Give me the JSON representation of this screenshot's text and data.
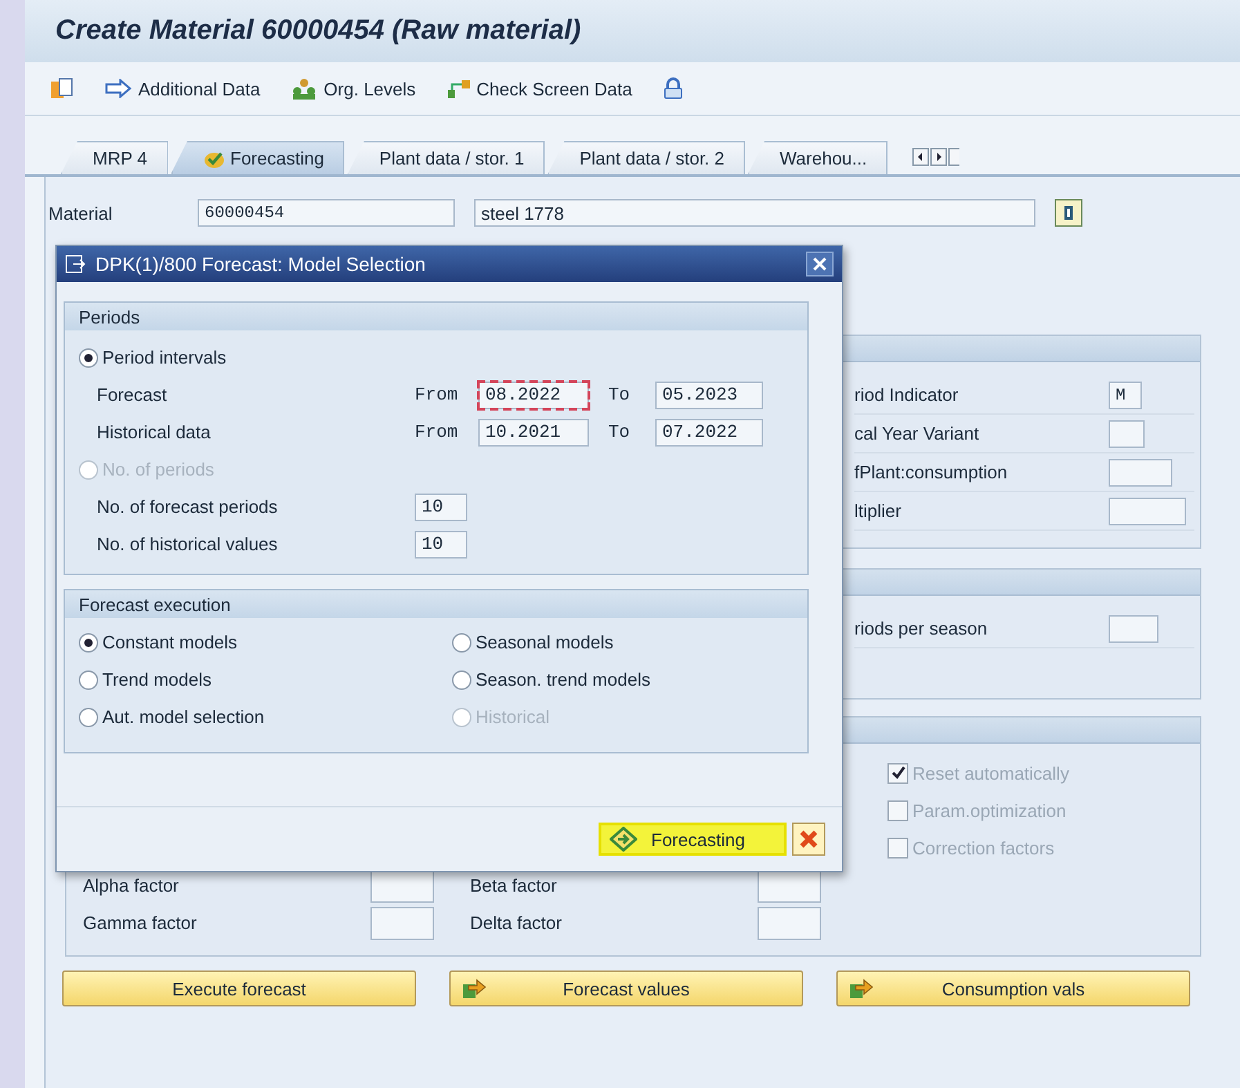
{
  "window": {
    "title": "Create Material 60000454 (Raw material)"
  },
  "toolbar": [
    {
      "kind": "copy"
    },
    {
      "kind": "arrow",
      "label": "Additional Data"
    },
    {
      "kind": "org",
      "label": "Org. Levels"
    },
    {
      "kind": "check",
      "label": "Check Screen Data"
    },
    {
      "kind": "lock"
    }
  ],
  "tabs": [
    {
      "label": "MRP 4",
      "selected": false,
      "kind": "plain"
    },
    {
      "label": "Forecasting",
      "selected": true,
      "kind": "status"
    },
    {
      "label": "Plant data / stor. 1",
      "selected": false,
      "kind": "plain"
    },
    {
      "label": "Plant data / stor. 2",
      "selected": false,
      "kind": "plain"
    },
    {
      "label": "Warehou...",
      "selected": false,
      "kind": "plain"
    }
  ],
  "material": {
    "label": "Material",
    "number": "60000454",
    "description": "steel 1778"
  },
  "panels": [
    {
      "rows": [
        {
          "label": "riod Indicator",
          "value": "M"
        },
        {
          "label": "cal Year Variant"
        },
        {
          "label": "fPlant:consumption"
        },
        {
          "label": "ltiplier"
        }
      ]
    },
    {
      "rows": [
        {
          "label": "riods per season"
        }
      ]
    }
  ],
  "control_panel": {
    "checkboxes": [
      {
        "label": "Reset automatically",
        "checked": true
      },
      {
        "label": "Param.optimization",
        "checked": false
      },
      {
        "label": "Correction factors",
        "checked": false
      }
    ],
    "factors": [
      {
        "label": "Alpha factor"
      },
      {
        "label": "Beta factor"
      },
      {
        "label": "Gamma factor"
      },
      {
        "label": "Delta factor"
      }
    ]
  },
  "buttons": [
    {
      "label": "Execute forecast",
      "kind": "plain"
    },
    {
      "label": "Forecast values",
      "kind": "arrow"
    },
    {
      "label": "Consumption vals",
      "kind": "arrow"
    }
  ],
  "dialog": {
    "title": "DPK(1)/800 Forecast: Model Selection",
    "periods": {
      "title": "Periods",
      "interval_option": {
        "label": "Period intervals",
        "selected": true,
        "disabled": false
      },
      "intervals": [
        {
          "label": "Forecast",
          "from_label": "From",
          "from": "08.2022",
          "focused": true,
          "to_label": "To",
          "to": "05.2023"
        },
        {
          "label": "Historical data",
          "from_label": "From",
          "from": "10.2021",
          "focused": false,
          "to_label": "To",
          "to": "07.2022"
        }
      ],
      "count_option": {
        "label": "No. of periods",
        "selected": false,
        "disabled": true
      },
      "counts": [
        {
          "label": "No. of forecast periods",
          "value": "10"
        },
        {
          "label": "No. of historical values",
          "value": "10"
        }
      ]
    },
    "execution": {
      "title": "Forecast execution",
      "models": [
        {
          "label": "Constant models",
          "selected": true,
          "disabled": false
        },
        {
          "label": "Seasonal models",
          "selected": false,
          "disabled": false
        },
        {
          "label": "Trend models",
          "selected": false,
          "disabled": false
        },
        {
          "label": "Season. trend models",
          "selected": false,
          "disabled": false
        },
        {
          "label": "Aut. model selection",
          "selected": false,
          "disabled": false
        },
        {
          "label": "Historical",
          "selected": false,
          "disabled": true
        }
      ]
    },
    "buttons": [
      {
        "kind": "execute",
        "label": "Forecasting",
        "highlighted": true
      },
      {
        "kind": "cancel"
      }
    ]
  }
}
